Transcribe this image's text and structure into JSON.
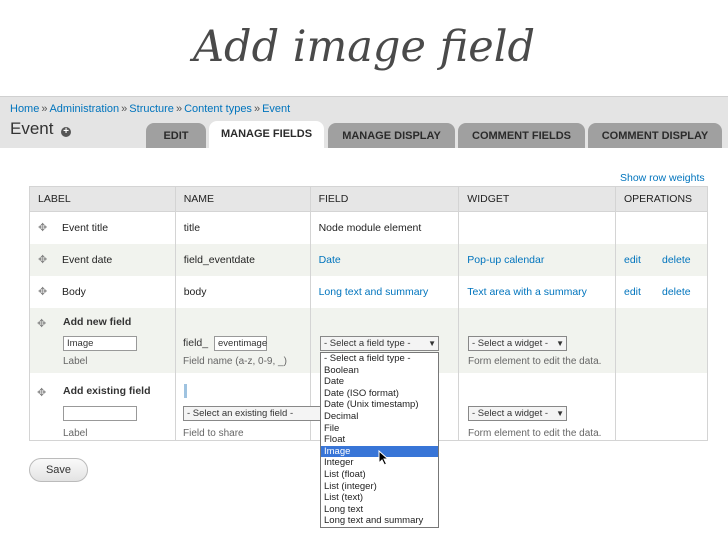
{
  "slide_title": "Add image field",
  "breadcrumb": [
    "Home",
    "Administration",
    "Structure",
    "Content types",
    "Event"
  ],
  "breadcrumb_sep": "»",
  "page_title": "Event",
  "tabs": [
    "EDIT",
    "MANAGE FIELDS",
    "MANAGE DISPLAY",
    "COMMENT FIELDS",
    "COMMENT DISPLAY"
  ],
  "active_tab": "MANAGE FIELDS",
  "show_row_weights": "Show row weights",
  "columns": [
    "LABEL",
    "NAME",
    "FIELD",
    "WIDGET",
    "OPERATIONS"
  ],
  "rows": [
    {
      "label": "Event title",
      "name": "title",
      "field": "Node module element",
      "widget": "",
      "edit": "",
      "delete": ""
    },
    {
      "label": "Event date",
      "name": "field_eventdate",
      "field": "Date",
      "widget": "Pop-up calendar",
      "edit": "edit",
      "delete": "delete"
    },
    {
      "label": "Body",
      "name": "body",
      "field": "Long text and summary",
      "widget": "Text area with a summary",
      "edit": "edit",
      "delete": "delete"
    }
  ],
  "add_new_field": {
    "title": "Add new field",
    "label_value": "Image",
    "label_caption": "Label",
    "name_prefix": "field_",
    "name_value": "eventimage",
    "name_caption": "Field name (a-z, 0-9, _)",
    "field_select": "- Select a field type -",
    "widget_select": "- Select a widget -",
    "widget_caption": "Form element to edit the data."
  },
  "add_existing_field": {
    "title": "Add existing field",
    "label_value": "",
    "label_caption": "Label",
    "field_select": "- Select an existing field -",
    "field_caption": "Field to share",
    "widget_select": "- Select a widget -",
    "widget_caption": "Form element to edit the data."
  },
  "field_type_options": [
    "- Select a field type -",
    "Boolean",
    "Date",
    "Date (ISO format)",
    "Date (Unix timestamp)",
    "Decimal",
    "File",
    "Float",
    "Image",
    "Integer",
    "List (float)",
    "List (integer)",
    "List (text)",
    "Long text",
    "Long text and summary"
  ],
  "highlighted_option": "Image",
  "save_label": "Save",
  "colors": {
    "link": "#0074bd",
    "highlight": "#3875d7",
    "tab": "#a0a0a0",
    "row_alt": "#f1f3ee"
  }
}
